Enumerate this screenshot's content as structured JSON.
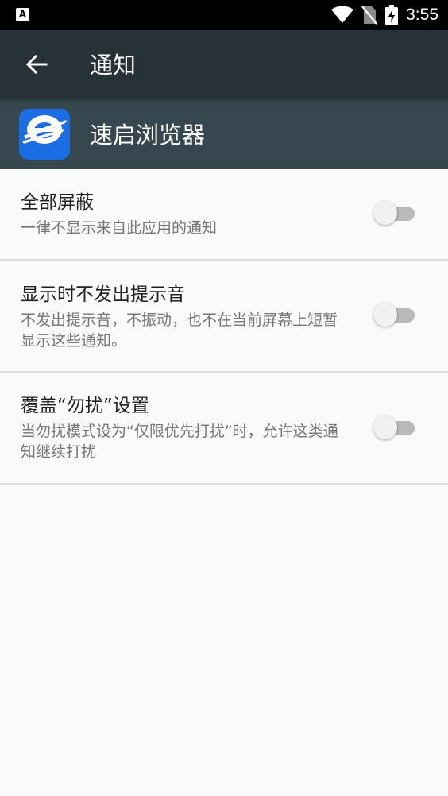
{
  "status_bar": {
    "time": "3:55",
    "left_icon_label": "A",
    "icons": [
      "wifi-icon",
      "no-sim-icon",
      "battery-charging-icon"
    ]
  },
  "toolbar": {
    "title": "通知",
    "back_icon": "arrow-back-icon"
  },
  "app": {
    "name": "速启浏览器",
    "icon_text": "速启浏览器"
  },
  "settings": [
    {
      "title": "全部屏蔽",
      "subtitle": "一律不显示来自此应用的通知",
      "enabled": false
    },
    {
      "title": "显示时不发出提示音",
      "subtitle": "不发出提示音，不振动，也不在当前屏幕上短暂显示这些通知。",
      "enabled": false
    },
    {
      "title": "覆盖“勿扰”设置",
      "subtitle": "当勿扰模式设为“仅限优先打扰”时，允许这类通知继续打扰",
      "enabled": false
    }
  ],
  "colors": {
    "status_bar": "#000000",
    "toolbar": "#263238",
    "app_header": "#37474f",
    "background": "#fafafa",
    "switch_track_off": "#b9b9b9",
    "switch_thumb_off": "#f1f1f1"
  }
}
